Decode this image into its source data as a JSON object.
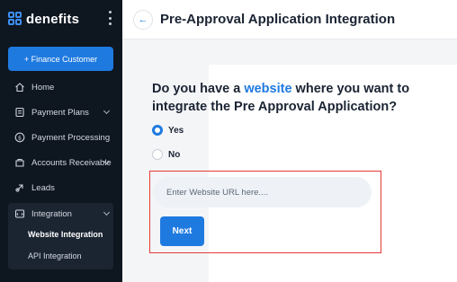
{
  "brand": {
    "name": "denefits"
  },
  "sidebar": {
    "finance_button": "+ Finance Customer",
    "items": [
      {
        "label": "Home",
        "icon": "home-icon"
      },
      {
        "label": "Payment Plans",
        "icon": "document-icon"
      },
      {
        "label": "Payment Processing",
        "icon": "dollar-icon"
      },
      {
        "label": "Accounts Receivable",
        "icon": "receivable-icon"
      },
      {
        "label": "Leads",
        "icon": "leads-icon"
      },
      {
        "label": "Integration",
        "icon": "integration-icon"
      }
    ],
    "sub_items": [
      {
        "label": "Website Integration"
      },
      {
        "label": "API Integration"
      }
    ]
  },
  "header": {
    "title": "Pre-Approval Application Integration"
  },
  "main": {
    "question_pre": "Do you have a ",
    "question_highlight": "website",
    "question_post": " where you want to integrate the Pre Approval Application?",
    "options": [
      {
        "label": "Yes",
        "checked": true
      },
      {
        "label": "No",
        "checked": false
      }
    ],
    "url_placeholder": "Enter Website URL here....",
    "url_value": "",
    "next_label": "Next"
  },
  "colors": {
    "accent": "#1f7ae0",
    "sidebar_bg": "#0e1620",
    "highlight_border": "#e53935"
  }
}
